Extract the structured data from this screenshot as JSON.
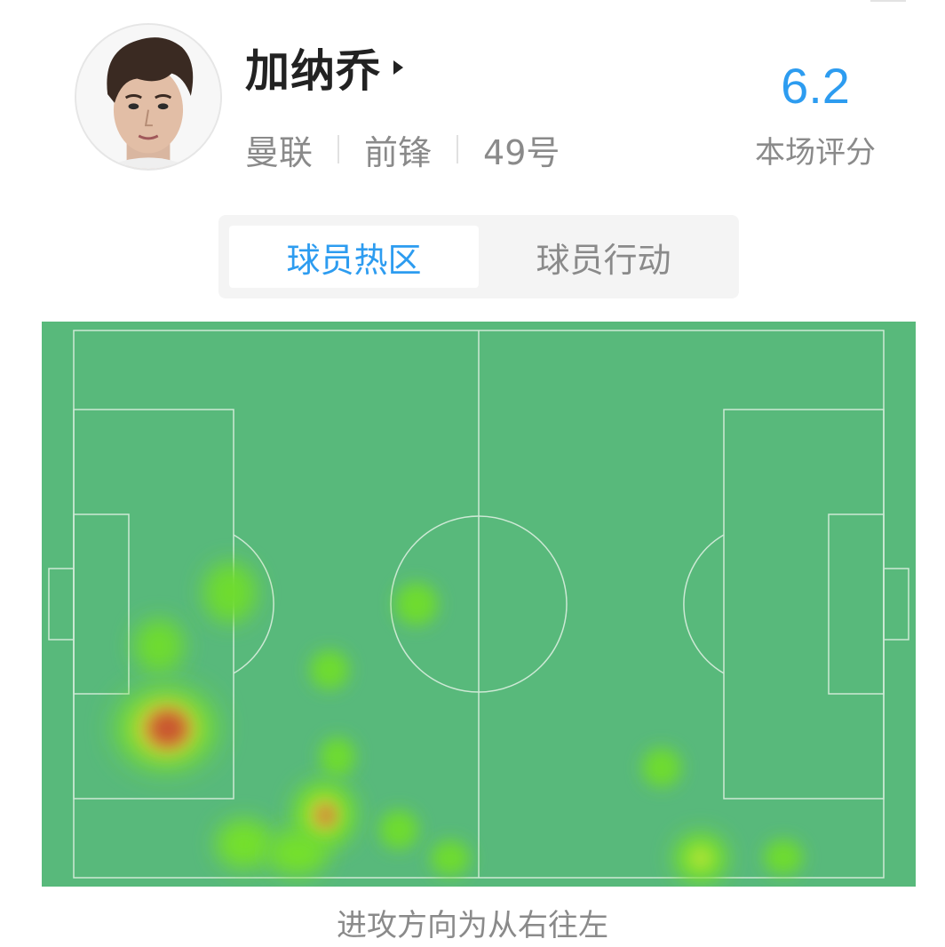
{
  "player": {
    "name": "加纳乔",
    "team": "曼联",
    "position": "前锋",
    "number": "49号"
  },
  "rating": {
    "value": "6.2",
    "label": "本场评分"
  },
  "tabs": [
    {
      "label": "球员热区",
      "active": true
    },
    {
      "label": "球员行动",
      "active": false
    }
  ],
  "heatmap": {
    "direction_note": "进攻方向为从右往左",
    "colors": {
      "pitch": "#58b97b",
      "low": "#7ee533",
      "high": "#c9552f",
      "lines": "#cde9d5"
    }
  },
  "icons": {
    "avatar": "player-photo",
    "name_arrow": "triangle-right-icon"
  }
}
